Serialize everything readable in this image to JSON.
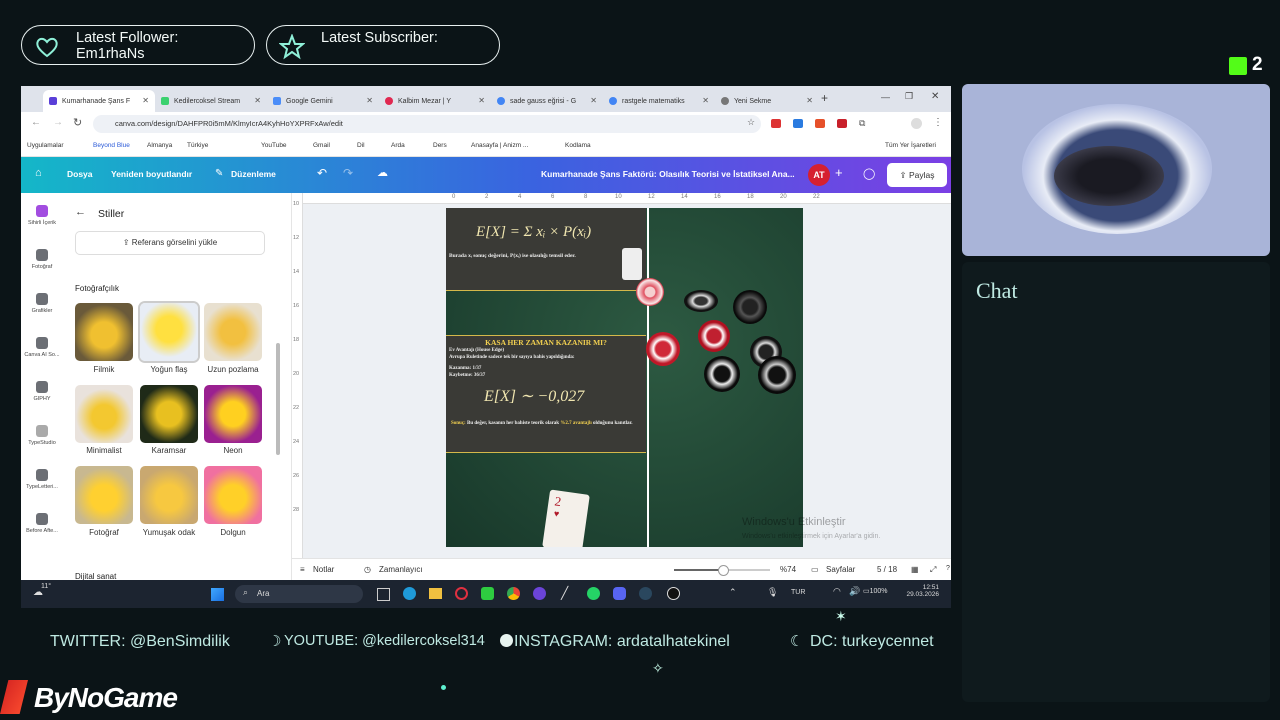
{
  "overlay": {
    "follower_label": "Latest Follower:",
    "follower_name": "Em1rhaNs",
    "subscriber_label": "Latest Subscriber:",
    "kick_count": "2",
    "chat_title": "Chat",
    "brand": "ByNoGame",
    "socials": {
      "twitter": "TWITTER: @BenSimdilik",
      "youtube": "YOUTUBE: @kedilercoksel314",
      "instagram": "INSTAGRAM: ardatalhatekinel",
      "discord": "DC: turkeycennet"
    }
  },
  "browser": {
    "tabs": [
      {
        "label": "Kumarhanade Şans F",
        "active": true,
        "color": "#5a3fd8"
      },
      {
        "label": "Kedilercoksel Stream",
        "active": false,
        "color": "#3bd16f"
      },
      {
        "label": "Google Gemini",
        "active": false,
        "color": "#4b8df8"
      },
      {
        "label": "Kalbim Mezar | Y",
        "active": false,
        "color": "#e02850"
      },
      {
        "label": "sade gauss eğrisi - G",
        "active": false,
        "color": "#4285f4"
      },
      {
        "label": "rastgele matematiks",
        "active": false,
        "color": "#4285f4"
      },
      {
        "label": "Yeni Sekme",
        "active": false,
        "color": "#777777"
      }
    ],
    "url": "canva.com/design/DAHFPR0i5mM/KlmyIcrA4KyhHoYXPRFxAw/edit",
    "bookmarks": [
      "Uygulamalar",
      "Beyond Blue",
      "Almanya",
      "Türkiye",
      "YouTube",
      "Gmail",
      "Dil",
      "Arda",
      "Ders",
      "Anasayfa | Anizm ...",
      "Kodlama"
    ],
    "all_bookmarks": "Tüm Yer İşaretleri"
  },
  "canva": {
    "menu": {
      "file": "Dosya",
      "resize": "Yeniden boyutlandır",
      "edit": "Düzenleme"
    },
    "title": "Kumarhanade Şans Faktörü: Olasılık Teorisi ve İstatiksel Ana...",
    "avatar": "AT",
    "share": "Paylaş",
    "rail": [
      {
        "label": "Sihirli İçerik"
      },
      {
        "label": "Fotoğraf"
      },
      {
        "label": "Grafikler"
      },
      {
        "label": "Canva AI So..."
      },
      {
        "label": "GIPHY"
      },
      {
        "label": "TypeStudio"
      },
      {
        "label": "TypeLetteri..."
      },
      {
        "label": "Before Afte..."
      }
    ],
    "panel_title": "Stiller",
    "upload_ref": "Referans görselini yükle",
    "section_photo": "Fotoğrafçılık",
    "section_digital": "Dijital sanat",
    "styles": [
      {
        "label": "Filmik"
      },
      {
        "label": "Yoğun flaş"
      },
      {
        "label": "Uzun pozlama"
      },
      {
        "label": "Minimalist"
      },
      {
        "label": "Karamsar"
      },
      {
        "label": "Neon"
      },
      {
        "label": "Fotoğraf"
      },
      {
        "label": "Yumuşak odak"
      },
      {
        "label": "Dolgun"
      }
    ],
    "ruler_top": [
      "0",
      "2",
      "4",
      "6",
      "8",
      "10",
      "12",
      "14",
      "16",
      "18",
      "20",
      "22"
    ],
    "ruler_left": [
      "10",
      "12",
      "14",
      "16",
      "18",
      "20",
      "22",
      "24",
      "26",
      "28"
    ],
    "slide": {
      "formula1": "E[X] = Σ xᵢ × P(xᵢ)",
      "formula_note": "Burada xᵢ sonuç değerini, P(xᵢ) ise olasılığı temsil eder.",
      "heading": "KASA HER ZAMAN KAZANIR MI?",
      "house_edge": "Ev Avantajı (House Edge)",
      "rule": "Avrupa Ruletinde sadece tek bir sayıya bahis yapıldığında:",
      "win": "Kazanma: 1/37",
      "lose": "Kaybetme: 36/37",
      "formula2": "E[X] ∼ −0,027",
      "result_label": "Sonuç:",
      "result_text": "Bu değer, kasanın her bahiste teorik olarak",
      "result_percent": "%2.7",
      "result_text2": "avantajlı",
      "result_text3": "olduğunu kanıtlar.",
      "card": "2"
    },
    "watermark1": "Windows'u Etkinleştir",
    "watermark2": "Windows'u etkinleştirmek için Ayarlar'a gidin.",
    "bottom": {
      "notes": "Notlar",
      "timer": "Zamanlayıcı",
      "zoom": "%74",
      "pages_label": "Sayfalar",
      "pages": "5 / 18"
    }
  },
  "taskbar": {
    "search": "Ara",
    "temp": "11°",
    "lang": "TUR",
    "battery": "100%",
    "time": "12:51",
    "date": "29.03.2026"
  }
}
